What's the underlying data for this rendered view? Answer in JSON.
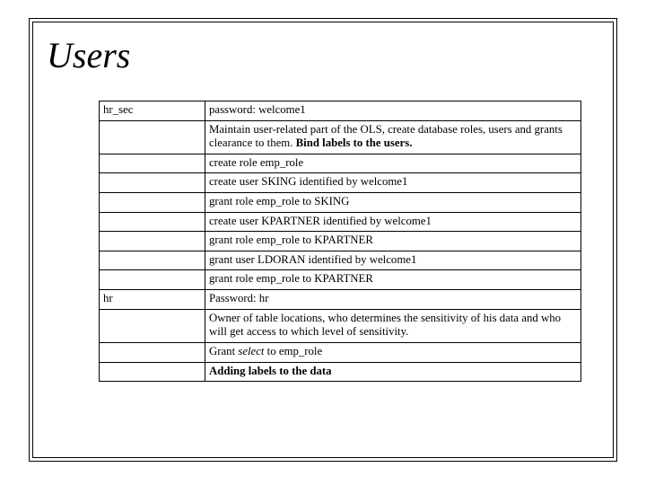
{
  "title": "Users",
  "rows": {
    "r0c0": "hr_sec",
    "r0c1": "password: welcome1",
    "r1_pre": "Maintain user-related part of the OLS, create database roles, users and grants clearance to them. ",
    "r1_bold": "Bind labels to the users.",
    "r2": "create role emp_role",
    "r3": "create user SKING identified by welcome1",
    "r4": "grant role emp_role to SKING",
    "r5": "create user KPARTNER identified by welcome1",
    "r6": "grant role emp_role to KPARTNER",
    "r7": "grant user LDORAN identified by welcome1",
    "r8": "grant role emp_role to KPARTNER",
    "r9c0": "hr",
    "r9c1": "Password: hr",
    "r10": "Owner of table locations, who determines the sensitivity of his data and who will get access to which level of sensitivity.",
    "r11_pre": "Grant ",
    "r11_ital": "select",
    "r11_post": " to emp_role",
    "r12_bold": "Adding labels to the data"
  }
}
